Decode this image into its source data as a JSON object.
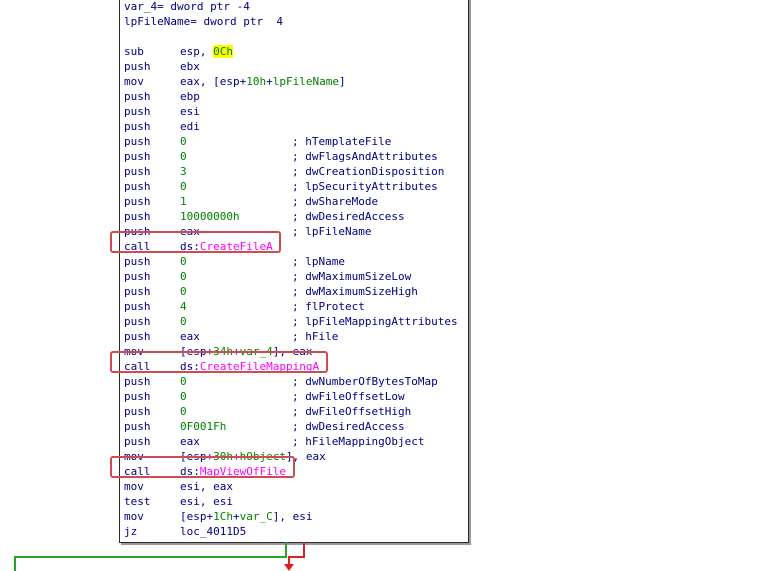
{
  "header": {
    "var_4_decl": "var_4= dword ptr -4",
    "lpFileName_decl": "lpFileName= dword ptr  4"
  },
  "instructions": [
    {
      "mnemonic": "sub",
      "operand_parts": [
        {
          "t": "esp, "
        },
        {
          "t": "0Ch",
          "cls": "num hl"
        }
      ],
      "comment": ""
    },
    {
      "mnemonic": "push",
      "operand_parts": [
        {
          "t": "ebx"
        }
      ],
      "comment": ""
    },
    {
      "mnemonic": "mov",
      "operand_parts": [
        {
          "t": "eax, [esp+"
        },
        {
          "t": "10h",
          "cls": "num"
        },
        {
          "t": "+"
        },
        {
          "t": "lpFileName",
          "cls": "num"
        },
        {
          "t": "]"
        }
      ],
      "comment": ""
    },
    {
      "mnemonic": "push",
      "operand_parts": [
        {
          "t": "ebp"
        }
      ],
      "comment": ""
    },
    {
      "mnemonic": "push",
      "operand_parts": [
        {
          "t": "esi"
        }
      ],
      "comment": ""
    },
    {
      "mnemonic": "push",
      "operand_parts": [
        {
          "t": "edi"
        }
      ],
      "comment": ""
    },
    {
      "mnemonic": "push",
      "operand_parts": [
        {
          "t": "0",
          "cls": "num"
        }
      ],
      "comment": "; hTemplateFile"
    },
    {
      "mnemonic": "push",
      "operand_parts": [
        {
          "t": "0",
          "cls": "num"
        }
      ],
      "comment": "; dwFlagsAndAttributes"
    },
    {
      "mnemonic": "push",
      "operand_parts": [
        {
          "t": "3",
          "cls": "num"
        }
      ],
      "comment": "; dwCreationDisposition"
    },
    {
      "mnemonic": "push",
      "operand_parts": [
        {
          "t": "0",
          "cls": "num"
        }
      ],
      "comment": "; lpSecurityAttributes"
    },
    {
      "mnemonic": "push",
      "operand_parts": [
        {
          "t": "1",
          "cls": "num"
        }
      ],
      "comment": "; dwShareMode"
    },
    {
      "mnemonic": "push",
      "operand_parts": [
        {
          "t": "10000000h",
          "cls": "num"
        }
      ],
      "comment": "; dwDesiredAccess"
    },
    {
      "mnemonic": "push",
      "operand_parts": [
        {
          "t": "eax"
        }
      ],
      "comment": "; lpFileName"
    },
    {
      "mnemonic": "call",
      "operand_parts": [
        {
          "t": "ds:"
        },
        {
          "t": "CreateFileA",
          "cls": "fn"
        }
      ],
      "comment": "",
      "boxed": true
    },
    {
      "mnemonic": "push",
      "operand_parts": [
        {
          "t": "0",
          "cls": "num"
        }
      ],
      "comment": "; lpName"
    },
    {
      "mnemonic": "push",
      "operand_parts": [
        {
          "t": "0",
          "cls": "num"
        }
      ],
      "comment": "; dwMaximumSizeLow"
    },
    {
      "mnemonic": "push",
      "operand_parts": [
        {
          "t": "0",
          "cls": "num"
        }
      ],
      "comment": "; dwMaximumSizeHigh"
    },
    {
      "mnemonic": "push",
      "operand_parts": [
        {
          "t": "4",
          "cls": "num"
        }
      ],
      "comment": "; flProtect"
    },
    {
      "mnemonic": "push",
      "operand_parts": [
        {
          "t": "0",
          "cls": "num"
        }
      ],
      "comment": "; lpFileMappingAttributes"
    },
    {
      "mnemonic": "push",
      "operand_parts": [
        {
          "t": "eax"
        }
      ],
      "comment": "; hFile"
    },
    {
      "mnemonic": "mov",
      "operand_parts": [
        {
          "t": "[esp+"
        },
        {
          "t": "34h",
          "cls": "num"
        },
        {
          "t": "+"
        },
        {
          "t": "var_4",
          "cls": "num"
        },
        {
          "t": "], eax"
        }
      ],
      "comment": ""
    },
    {
      "mnemonic": "call",
      "operand_parts": [
        {
          "t": "ds:"
        },
        {
          "t": "CreateFileMappingA",
          "cls": "fn"
        }
      ],
      "comment": "",
      "boxed": true
    },
    {
      "mnemonic": "push",
      "operand_parts": [
        {
          "t": "0",
          "cls": "num"
        }
      ],
      "comment": "; dwNumberOfBytesToMap"
    },
    {
      "mnemonic": "push",
      "operand_parts": [
        {
          "t": "0",
          "cls": "num"
        }
      ],
      "comment": "; dwFileOffsetLow"
    },
    {
      "mnemonic": "push",
      "operand_parts": [
        {
          "t": "0",
          "cls": "num"
        }
      ],
      "comment": "; dwFileOffsetHigh"
    },
    {
      "mnemonic": "push",
      "operand_parts": [
        {
          "t": "0F001Fh",
          "cls": "num"
        }
      ],
      "comment": "; dwDesiredAccess"
    },
    {
      "mnemonic": "push",
      "operand_parts": [
        {
          "t": "eax"
        }
      ],
      "comment": "; hFileMappingObject"
    },
    {
      "mnemonic": "mov",
      "operand_parts": [
        {
          "t": "[esp+"
        },
        {
          "t": "30h",
          "cls": "num"
        },
        {
          "t": "+"
        },
        {
          "t": "hObject",
          "cls": "num"
        },
        {
          "t": "], eax"
        }
      ],
      "comment": ""
    },
    {
      "mnemonic": "call",
      "operand_parts": [
        {
          "t": "ds:"
        },
        {
          "t": "MapViewOfFile",
          "cls": "fn"
        }
      ],
      "comment": "",
      "boxed": true
    },
    {
      "mnemonic": "mov",
      "operand_parts": [
        {
          "t": "esi, eax"
        }
      ],
      "comment": ""
    },
    {
      "mnemonic": "test",
      "operand_parts": [
        {
          "t": "esi, esi"
        }
      ],
      "comment": ""
    },
    {
      "mnemonic": "mov",
      "operand_parts": [
        {
          "t": "[esp+"
        },
        {
          "t": "1Ch",
          "cls": "num"
        },
        {
          "t": "+"
        },
        {
          "t": "var_C",
          "cls": "num"
        },
        {
          "t": "], esi"
        }
      ],
      "comment": ""
    },
    {
      "mnemonic": "jz",
      "operand_parts": [
        {
          "t": "loc_4011D5"
        }
      ],
      "comment": ""
    }
  ],
  "colors": {
    "text": "#000080",
    "number": "#008000",
    "highlight": "#ffff00",
    "api_name": "#ff00ff",
    "callout_box": "#d04a50",
    "edge_true": "#2ca02c",
    "edge_false": "#e02020"
  }
}
